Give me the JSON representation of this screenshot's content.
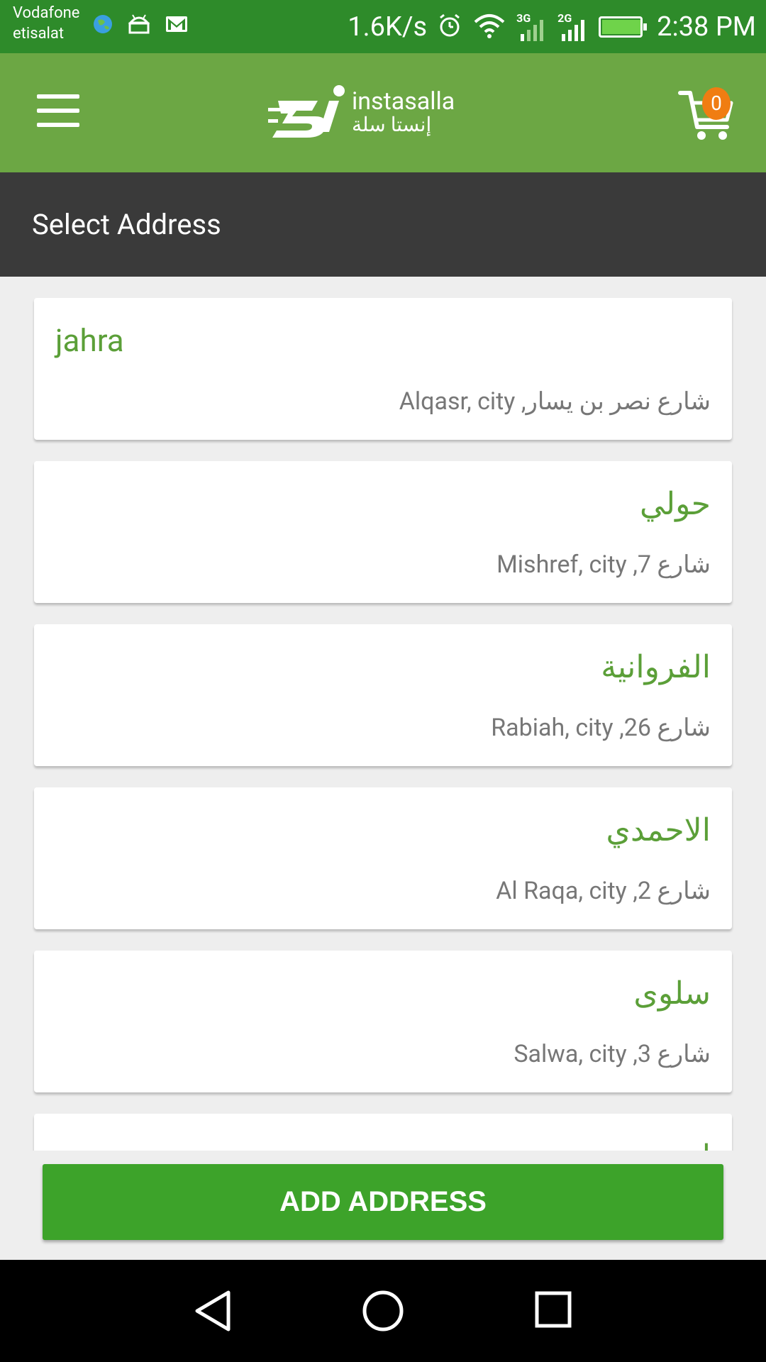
{
  "status_bar": {
    "carrier_1": "Vodafone",
    "carrier_2": "etisalat",
    "net_speed": "1.6K/s",
    "signal_1_type": "3G",
    "signal_2_type": "2G",
    "time": "2:38 PM",
    "icons": [
      "globe-icon",
      "android-icon",
      "gmail-icon",
      "alarm-icon",
      "wifi-icon",
      "signal-icon",
      "battery-charging-icon"
    ]
  },
  "app_bar": {
    "logo_en": "instasalla",
    "logo_ar": "إنستا سلة",
    "cart_count": "0",
    "accent": "#6ca744"
  },
  "page": {
    "title": "Select Address"
  },
  "addresses": [
    {
      "name": "jahra",
      "detail": "شارع نصر بن يسار, Alqasr, city",
      "dir": "ltr"
    },
    {
      "name": "حولي",
      "detail": "شارع 7, Mishref, city",
      "dir": "rtl"
    },
    {
      "name": "الفروانية",
      "detail": "شارع 26, Rabiah, city",
      "dir": "rtl"
    },
    {
      "name": "الاحمدي",
      "detail": "شارع 2, Al Raqa, city",
      "dir": "rtl"
    },
    {
      "name": "سلوى",
      "detail": "شارع 3, Salwa, city",
      "dir": "rtl"
    },
    {
      "name": "ا",
      "detail": "",
      "dir": "rtl"
    }
  ],
  "actions": {
    "add_address": "ADD ADDRESS",
    "button_color": "#3da32a"
  }
}
